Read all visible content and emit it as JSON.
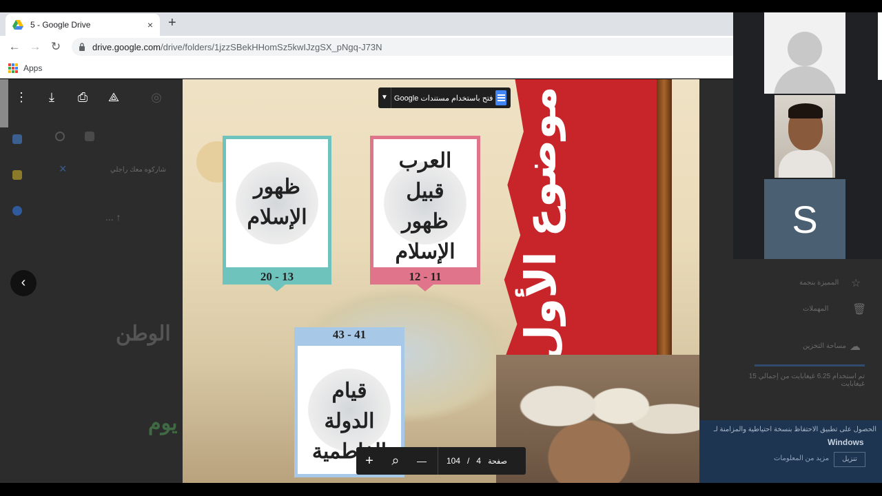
{
  "browser": {
    "tab_title": "5 - Google Drive",
    "tab_close": "×",
    "new_tab": "+",
    "url_host": "drive.google.com",
    "url_path": "/drive/folders/1jzzSBekHHomSz5kwIJzgSX_pNgq-J73N",
    "bookmark_apps": "Apps"
  },
  "viewer": {
    "open_with_label": "فتح باستخدام مستندات Google",
    "icons": [
      "more-vert-icon",
      "download-icon",
      "print-icon",
      "add-to-drive-icon"
    ],
    "back": "‹",
    "page_label": "صفحة",
    "page_current": "4",
    "page_separator": "/",
    "page_total": "104",
    "zoom_in": "+",
    "zoom_out": "—",
    "zoom_icon": "⌕"
  },
  "page_image": {
    "banner_text": "موضوع الأول تاريخ الإسلامي",
    "cards": [
      {
        "text": "ظهور الإسلام",
        "pages": "20 - 13",
        "color": "#6fc3bd"
      },
      {
        "text": "العرب قبيل ظهور الإسلام",
        "pages": "12 - 11",
        "color": "#e0748a"
      },
      {
        "text": "قيام الدولة الفاطمية",
        "pages": "43 - 41",
        "color": "#a8c8e8"
      }
    ]
  },
  "meet": {
    "initial": "S"
  },
  "windows_toast": {
    "text": "الحصول على تطبيق الاحتفاظ بنسخة احتياطية والمزامنة لـ",
    "title": "Windows",
    "button": "تنزيل",
    "link": "مزيد من المعلومات"
  },
  "drive_sidebar": {
    "starred": "المميزة بنجمة",
    "trash": "المهملات",
    "storage": "مساحة التخزين",
    "storage_usage": "تم استخدام 6.25 غيغابايت من إجمالي 15 غيغابايت"
  },
  "colors": {
    "banner_red": "#c8252b",
    "toolbar_dark": "#1f1f1f",
    "meet_tile_blue": "#4a6072",
    "docs_blue": "#4285f4"
  }
}
